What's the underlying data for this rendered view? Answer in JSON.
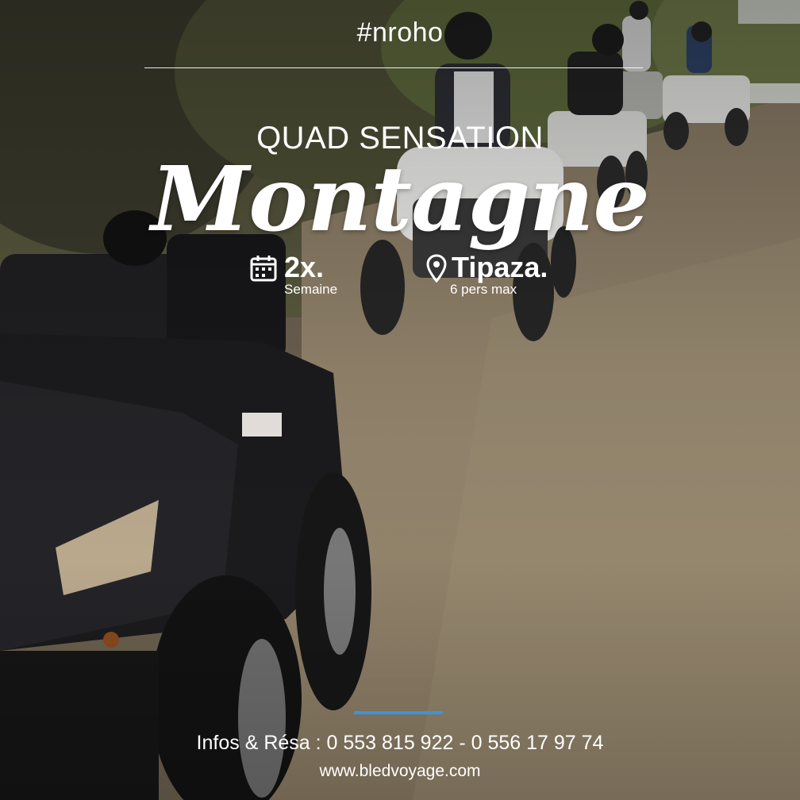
{
  "hashtag": "#nroho",
  "subtitle": "QUAD SENSATION",
  "title": "Montagne",
  "frequency": {
    "icon": "calendar-icon",
    "value": "2x.",
    "label": "Semaine"
  },
  "location": {
    "icon": "map-pin-icon",
    "value": "Tipaza.",
    "label": "6 pers max"
  },
  "contact": "Infos & Résa : 0 553 815 922 - 0 556 17 97 74",
  "website": "www.bledvoyage.com",
  "colors": {
    "accent": "#3a95de",
    "text": "#ffffff"
  }
}
